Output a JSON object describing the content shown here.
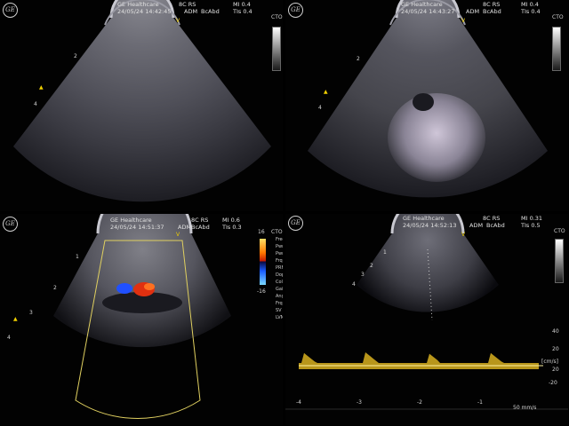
{
  "panels": {
    "p1": {
      "brand": "GE Healthcare",
      "datetime": "24/05/24 14:42:45",
      "user": "ADM",
      "probe": "8C RS",
      "preset": "BcAbd",
      "mi": "MI 0.4",
      "tis": "TIs 0.4",
      "depth_marks": [
        "2",
        "4"
      ],
      "marker": "V",
      "side_label": "CTO"
    },
    "p2": {
      "brand": "GE Healthcare",
      "datetime": "24/05/24 14:43:27",
      "user": "ADM",
      "probe": "8C RS",
      "preset": "BcAbd",
      "mi": "MI 0.4",
      "tis": "TIs 0.4",
      "depth_marks": [
        "2",
        "4"
      ],
      "marker": "V",
      "side_label": "CTO"
    },
    "p3": {
      "brand": "GE Healthcare",
      "datetime": "24/05/24 14:51:37",
      "user": "ADM",
      "probe": "8C RS",
      "preset": "BcAbd",
      "mi": "MI 0.6",
      "tis": "TIs 0.3",
      "depth_marks": [
        "1",
        "2",
        "3",
        "4"
      ],
      "marker": "V",
      "side_label": "CTO",
      "scale_top": "16",
      "scale_bottom": "-16",
      "params": [
        "Freq",
        "Pwr",
        "Pwr",
        "Frq",
        "PRF",
        "Dop",
        "Colo",
        "Gai",
        "Ang",
        "Frq",
        "SV",
        "LVM"
      ]
    },
    "p4": {
      "brand": "GE Healthcare",
      "datetime": "24/05/24 14:52:13",
      "user": "ADM",
      "probe": "8C RS",
      "preset": "BcAbd",
      "mi": "MI 0.31",
      "tis": "TIs 0.5",
      "depth_marks": [
        "1",
        "2",
        "3",
        "4"
      ],
      "marker": "V",
      "side_label": "CTO",
      "velocity_unit": "[cm/s]",
      "velocity_ticks": [
        "40",
        "20",
        "20",
        "-20"
      ],
      "time_ticks": [
        "-4",
        "-3",
        "-2",
        "-1"
      ],
      "time_scale": "50 mm/s"
    }
  },
  "colors": {
    "accent": "#f0d000",
    "doppler_red": "#e03010",
    "doppler_blue": "#2050ff",
    "spectral": "#d8b020"
  }
}
